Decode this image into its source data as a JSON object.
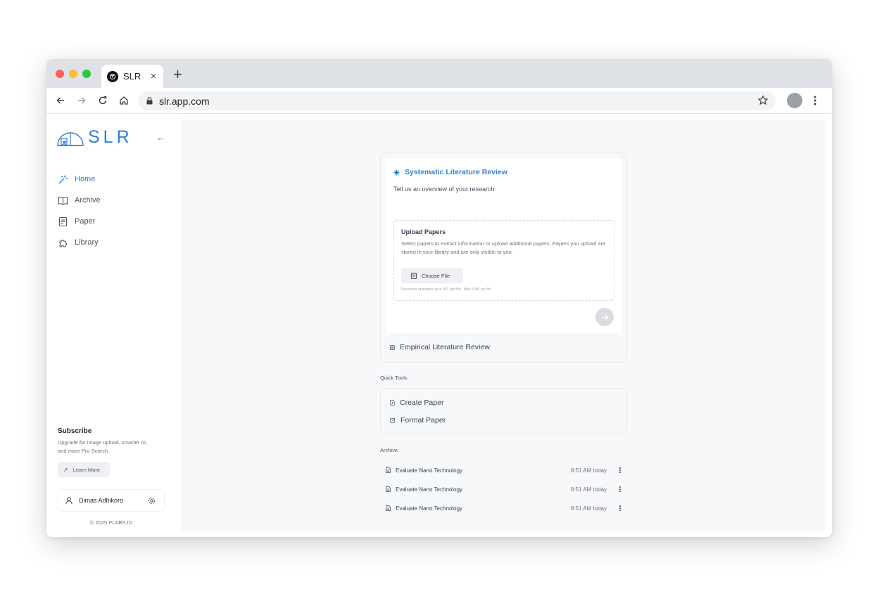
{
  "browser": {
    "tab_title": "SLR",
    "tab_close": "×",
    "new_tab": "+",
    "url": "slr.app.com"
  },
  "sidebar": {
    "logo_text": "SLR",
    "collapse": "←",
    "nav": [
      {
        "label": "Home",
        "icon": "magic-wand-icon",
        "active": true
      },
      {
        "label": "Archive",
        "icon": "book-open-icon",
        "active": false
      },
      {
        "label": "Paper",
        "icon": "document-icon",
        "active": false
      },
      {
        "label": "Library",
        "icon": "puzzle-icon",
        "active": false
      }
    ],
    "subscribe": {
      "title": "Subscribe",
      "description_line1": "Upgrade for image upload, smarter AI,",
      "description_line2": "and more Pro Search.",
      "button": "Learn More"
    },
    "user": {
      "name": "Dimas Adhikoro"
    },
    "copyright": "© 2025 PLABS.ID"
  },
  "main": {
    "slr_card": {
      "title": "Systematic Literature Review",
      "subtitle": "Tell us an overview of your research",
      "upload": {
        "title": "Upload Papers",
        "description": "Select papers to extract information or upload additional papers. Papers you upload are stored in your library and are only visible to you.",
        "button": "Choose File",
        "note": "Document uploaded up to 200 .pdf file · Max 5 MB per file"
      },
      "alt_option": "Empirical Literature Review"
    },
    "quick_tools": {
      "label": "Quick Tools",
      "items": [
        "Create Paper",
        "Format Paper"
      ]
    },
    "archive": {
      "label": "Archive",
      "rows": [
        {
          "title": "Evaluate Nano Technology",
          "time": "8:51 AM today"
        },
        {
          "title": "Evaluate Nano Technology",
          "time": "8:51 AM today"
        },
        {
          "title": "Evaluate Nano Technology",
          "time": "8:51 AM today"
        }
      ]
    }
  },
  "colors": {
    "accent": "#2f7fd3",
    "background": "#f7f8fa"
  }
}
